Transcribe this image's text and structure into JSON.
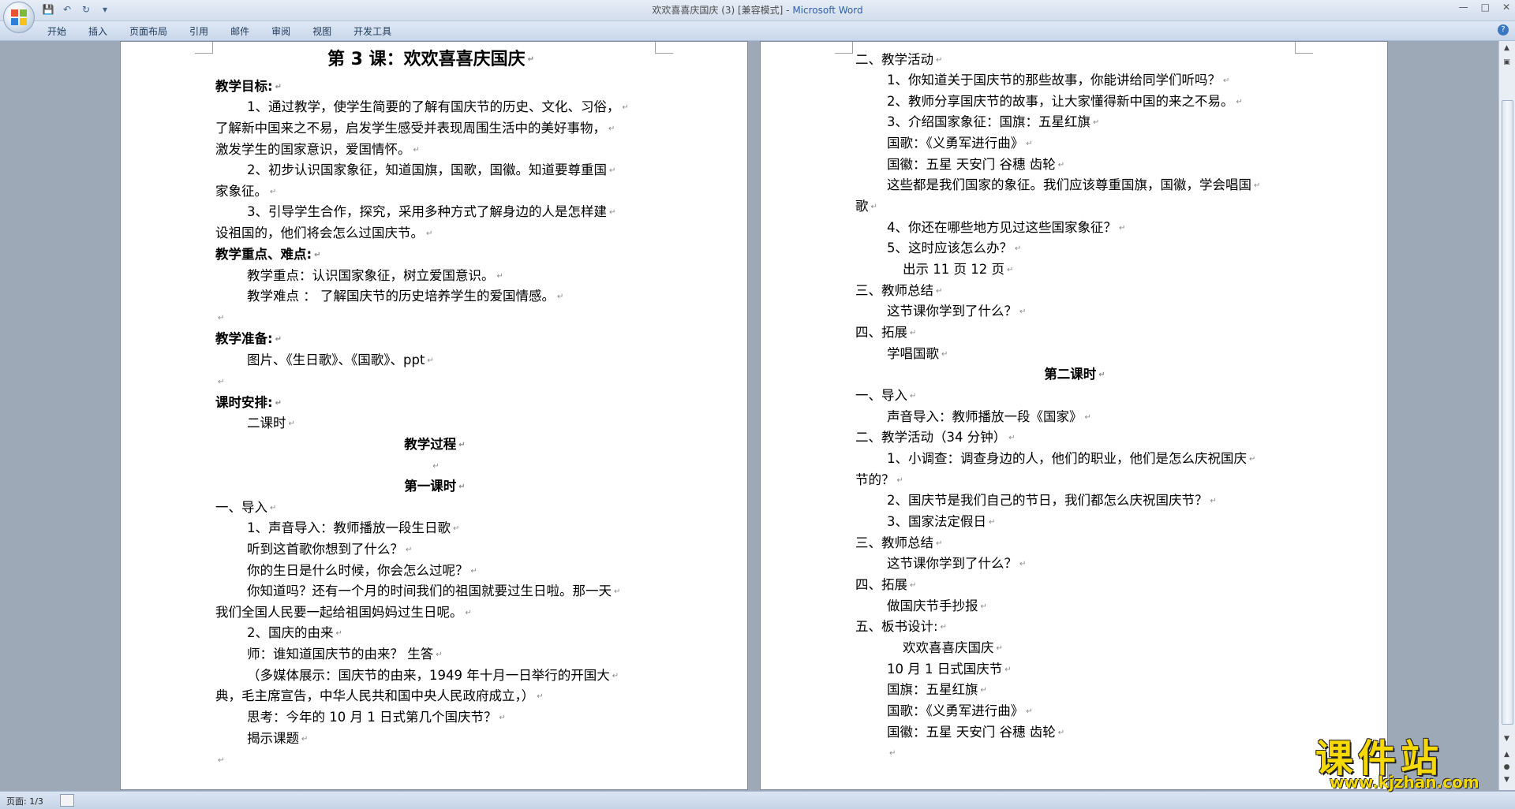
{
  "window": {
    "title": "欢欢喜喜庆国庆 (3) [兼容模式] - ",
    "app_name": "Microsoft Word",
    "controls": {
      "minimize": "—",
      "maximize": "□",
      "close": "✕"
    }
  },
  "quick_access": {
    "save_icon": "save-icon",
    "undo_icon": "undo-icon",
    "redo_icon": "redo-icon",
    "customize_icon": "dropdown-icon"
  },
  "ribbon": {
    "tabs": [
      "开始",
      "插入",
      "页面布局",
      "引用",
      "邮件",
      "审阅",
      "视图",
      "开发工具"
    ],
    "help": "?"
  },
  "status_bar": {
    "page": "页面: 1/3"
  },
  "watermark": {
    "text": "课件站",
    "url": "www.kjzhan.com"
  },
  "document": {
    "page1": {
      "lines": [
        "第 3 课：欢欢喜喜庆国庆",
        "教学目标:",
        "1、通过教学，使学生简要的了解有国庆节的历史、文化、习俗，",
        "了解新中国来之不易，启发学生感受并表现周围生活中的美好事物，",
        "激发学生的国家意识，爱国情怀。",
        "2、初步认识国家象征，知道国旗，国歌，国徽。知道要尊重国",
        "家象征。",
        "3、引导学生合作，探究，采用多种方式了解身边的人是怎样建",
        "设祖国的，他们将会怎么过国庆节。",
        "教学重点、难点:",
        "教学重点：认识国家象征，树立爱国意识。",
        "教学难点 ： 了解国庆节的历史培养学生的爱国情感。",
        "",
        "教学准备:",
        "图片、《生日歌》、《国歌》、ppt",
        "",
        "课时安排:",
        "二课时",
        "教学过程",
        "",
        "第一课时",
        "一、导入",
        "1、声音导入：教师播放一段生日歌",
        "听到这首歌你想到了什么？",
        "你的生日是什么时候，你会怎么过呢？",
        "你知道吗？还有一个月的时间我们的祖国就要过生日啦。那一天",
        "我们全国人民要一起给祖国妈妈过生日呢。",
        "2、国庆的由来",
        "师：谁知道国庆节的由来？       生答",
        "（多媒体展示：国庆节的由来，1949 年十月一日举行的开国大",
        "典，毛主席宣告，中华人民共和国中央人民政府成立，）",
        "思考：今年的 10 月 1 日式第几个国庆节？",
        "揭示课题",
        ""
      ]
    },
    "page2": {
      "lines": [
        "二、教学活动",
        "1、你知道关于国庆节的那些故事，你能讲给同学们听吗？",
        "2、教师分享国庆节的故事，让大家懂得新中国的来之不易。",
        "3、介绍国家象征：国旗：五星红旗",
        "国歌：《义勇军进行曲》",
        "国徽：五星 天安门 谷穗 齿轮",
        "这些都是我们国家的象征。我们应该尊重国旗，国徽，学会唱国",
        "歌",
        "4、你还在哪些地方见过这些国家象征？",
        "5、这时应该怎么办？",
        "出示 11 页 12 页",
        "三、教师总结",
        "这节课你学到了什么？",
        "四、拓展",
        "学唱国歌",
        "第二课时",
        "一、导入",
        "声音导入：教师播放一段《国家》",
        "二、教学活动（34 分钟）",
        "1、小调查：调查身边的人，他们的职业，他们是怎么庆祝国庆",
        "节的？",
        "2、国庆节是我们自己的节日，我们都怎么庆祝国庆节？",
        "3、国家法定假日",
        "三、教师总结",
        "这节课你学到了什么？",
        "四、拓展",
        "做国庆节手抄报",
        "五、板书设计:",
        "欢欢喜喜庆国庆",
        "10 月 1 日式国庆节",
        "国旗：五星红旗",
        "国歌：《义勇军进行曲》",
        "国徽：五星 天安门 谷穗 齿轮",
        ""
      ]
    }
  }
}
